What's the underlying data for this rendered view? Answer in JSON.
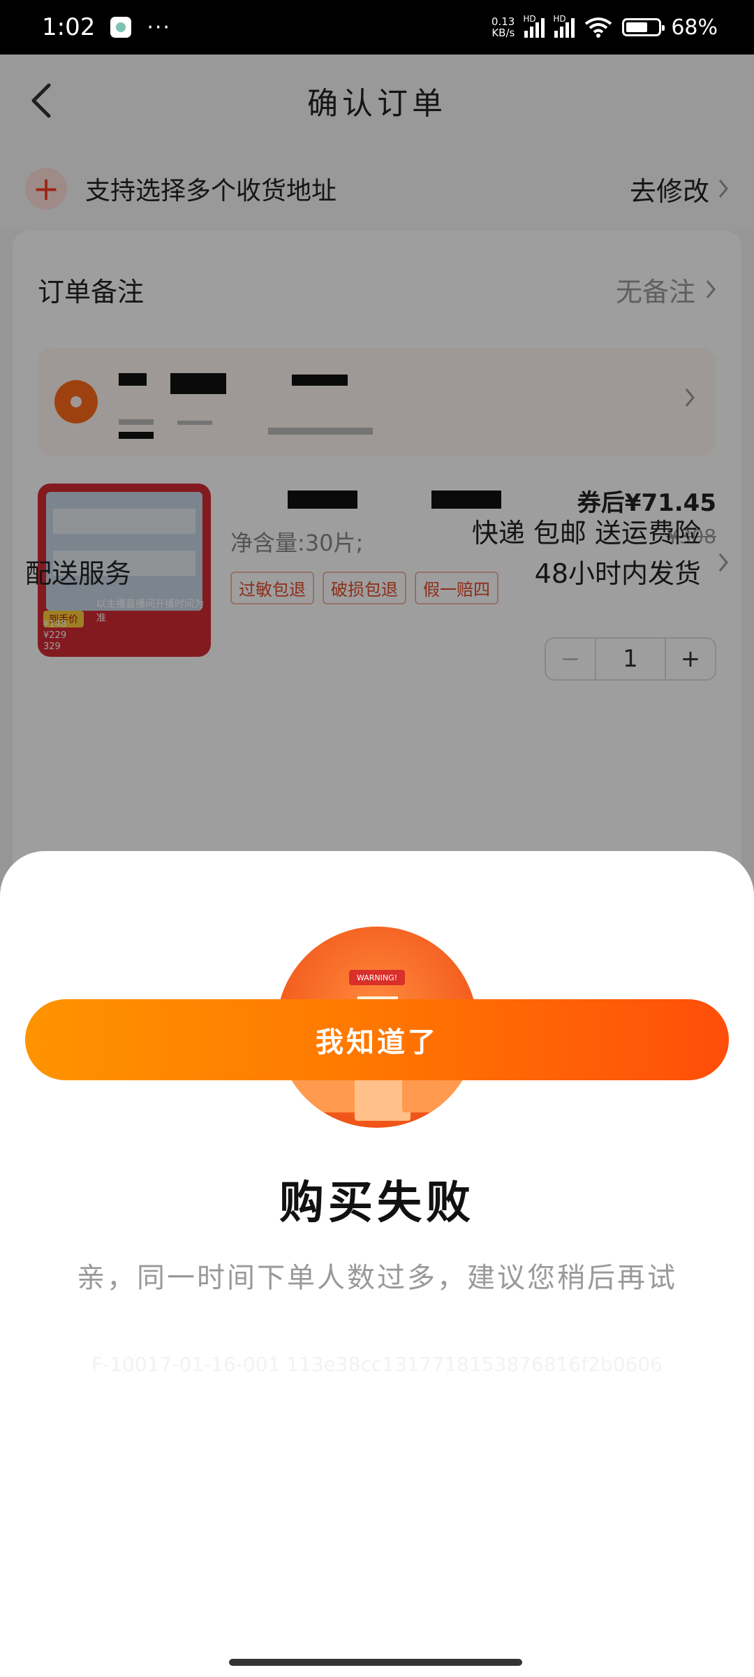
{
  "status_bar": {
    "time": "1:02",
    "dots": "···",
    "speed_value": "0.13",
    "speed_unit": "KB/s",
    "signal_label_1": "HD",
    "signal_label_2": "HD",
    "battery": "68%",
    "battery_level": 0.68
  },
  "nav": {
    "title": "确认订单"
  },
  "address_tip": {
    "text": "支持选择多个收货地址",
    "action": "去修改"
  },
  "remark": {
    "label": "订单备注",
    "value": "无备注"
  },
  "product": {
    "thumb_tag": "到手价",
    "thumb_caption": "以主播直播间开播时间为准",
    "thumb_price_1": "¥148",
    "thumb_price_2": "¥229",
    "thumb_price_3": "329",
    "spec": "净含量:30片;",
    "badges": [
      "过敏包退",
      "破损包退",
      "假一赔四"
    ],
    "price_after_coupon": "券后¥71.45",
    "original_price": "¥308",
    "quantity": "1"
  },
  "delivery": {
    "label": "配送服务",
    "line1": "快递 包邮 送运费险",
    "line2": "48小时内发货"
  },
  "dialog": {
    "illustration_text": "WARNING!",
    "title": "购买失败",
    "message": "亲，同一时间下单人数过多，建议您稍后再试",
    "trace": "F-10017-01-16-001 113e38cc1317718153876816f2b0606",
    "button": "我知道了"
  },
  "colors": {
    "accent_start": "#ff9300",
    "accent_end": "#ff4e0a",
    "price_red": "#e24a2a"
  }
}
